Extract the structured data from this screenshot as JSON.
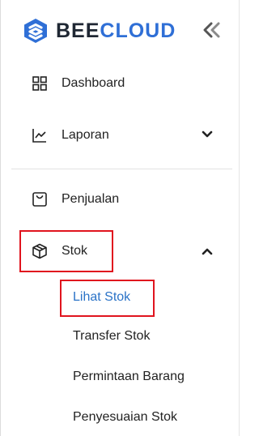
{
  "brand": {
    "part1": "BEE",
    "part2": "CLOUD",
    "accent_color": "#2f6fd6",
    "dark_color": "#1f2733",
    "logo_icon": "beecloud-hexagon-icon",
    "collapse_icon": "double-chevron-left-icon"
  },
  "nav": {
    "dashboard": {
      "label": "Dashboard",
      "icon": "grid-icon"
    },
    "laporan": {
      "label": "Laporan",
      "icon": "line-chart-icon",
      "chevron": "chevron-down-icon"
    },
    "penjualan": {
      "label": "Penjualan",
      "icon": "shopping-bag-icon"
    },
    "stok": {
      "label": "Stok",
      "icon": "box-icon",
      "chevron": "chevron-up-icon",
      "expanded": true
    }
  },
  "stok_submenu": [
    {
      "label": "Lihat Stok",
      "active": true
    },
    {
      "label": "Transfer Stok",
      "active": false
    },
    {
      "label": "Permintaan Barang",
      "active": false
    },
    {
      "label": "Penyesuaian Stok",
      "active": false
    }
  ],
  "colors": {
    "highlight": "#e0141e",
    "active_link": "#2b73c7"
  }
}
